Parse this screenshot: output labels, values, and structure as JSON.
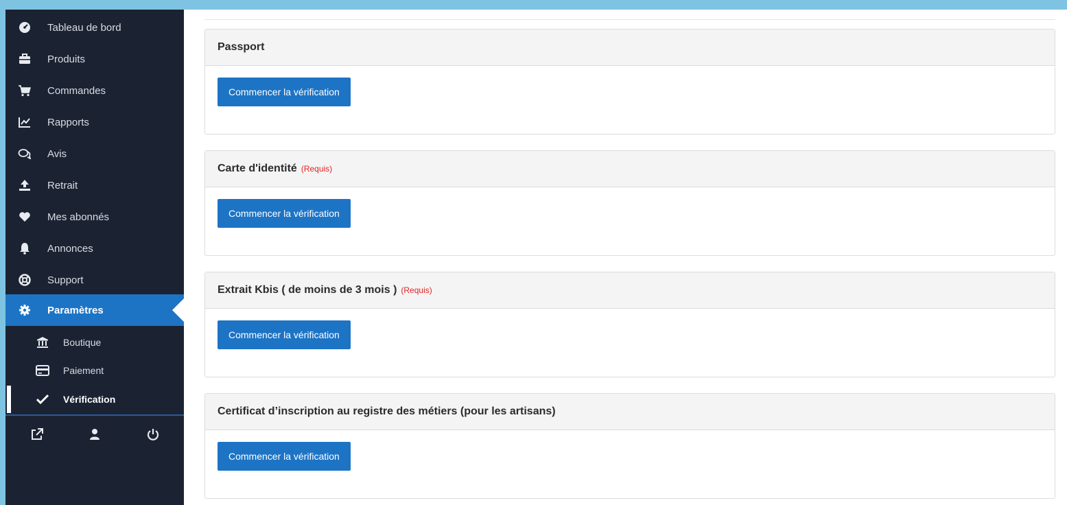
{
  "sidebar": {
    "items": [
      {
        "label": "Tableau de bord",
        "icon": "dashboard-icon"
      },
      {
        "label": "Produits",
        "icon": "briefcase-icon"
      },
      {
        "label": "Commandes",
        "icon": "cart-icon"
      },
      {
        "label": "Rapports",
        "icon": "chart-icon"
      },
      {
        "label": "Avis",
        "icon": "comments-icon"
      },
      {
        "label": "Retrait",
        "icon": "upload-icon"
      },
      {
        "label": "Mes abonnés",
        "icon": "heart-icon"
      },
      {
        "label": "Annonces",
        "icon": "bell-icon"
      },
      {
        "label": "Support",
        "icon": "lifebuoy-icon"
      },
      {
        "label": "Paramètres",
        "icon": "gear-icon"
      }
    ],
    "sub_items": [
      {
        "label": "Boutique",
        "icon": "bank-icon"
      },
      {
        "label": "Paiement",
        "icon": "credit-card-icon"
      },
      {
        "label": "Vérification",
        "icon": "check-icon"
      }
    ],
    "bottom_icons": [
      "external-link-icon",
      "user-icon",
      "power-icon"
    ]
  },
  "main": {
    "panels": [
      {
        "title": "Passport",
        "required": "",
        "button": "Commencer la vérification"
      },
      {
        "title": "Carte d'identité",
        "required": "(Requis)",
        "button": "Commencer la vérification"
      },
      {
        "title": "Extrait Kbis ( de moins de 3 mois )",
        "required": "(Requis)",
        "button": "Commencer la vérification"
      },
      {
        "title": "Certificat d’inscription au registre des métiers (pour les artisans)",
        "required": "",
        "button": "Commencer la vérification"
      }
    ]
  },
  "colors": {
    "sidebar_bg": "#1b2333",
    "accent": "#1d74c5",
    "required": "#e02424",
    "frame_bg": "#7ec4e2"
  }
}
